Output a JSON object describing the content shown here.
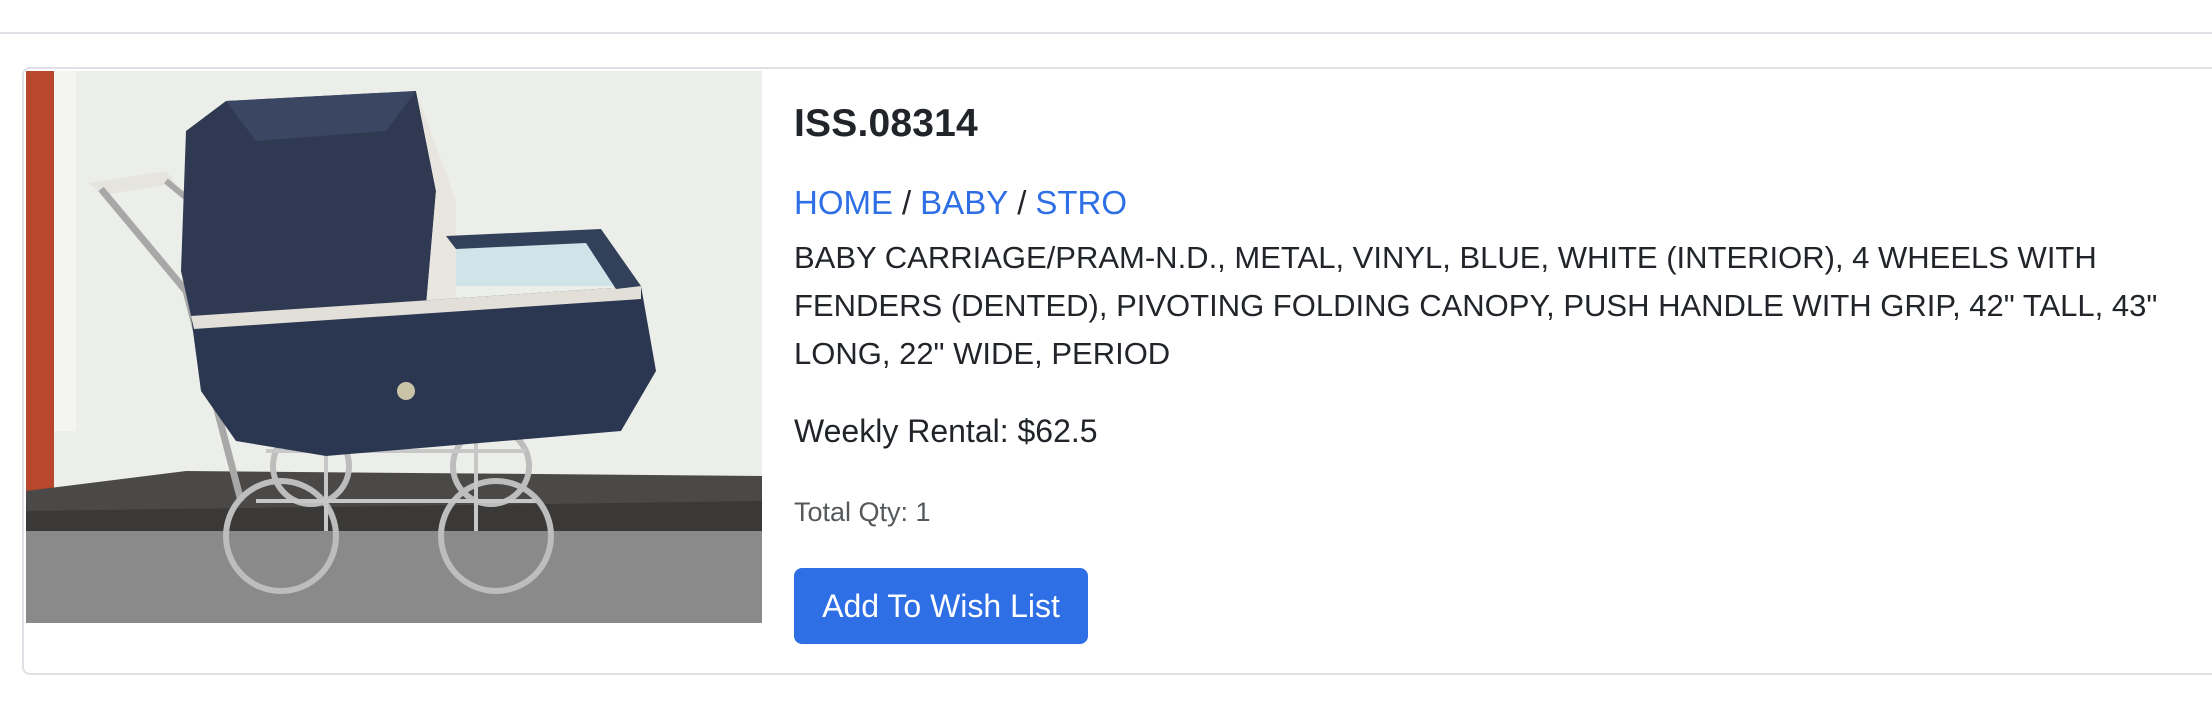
{
  "product": {
    "code": "ISS.08314",
    "breadcrumb": [
      {
        "label": "HOME"
      },
      {
        "label": "BABY"
      },
      {
        "label": "STRO"
      }
    ],
    "breadcrumb_separator": "/",
    "description": "BABY CARRIAGE/PRAM-N.D., METAL, VINYL, BLUE, WHITE (INTERIOR), 4 WHEELS WITH FENDERS (DENTED), PIVOTING FOLDING CANOPY, PUSH HANDLE WITH GRIP, 42\" TALL, 43\" LONG, 22\" WIDE, PERIOD",
    "weekly_rental": "Weekly Rental: $62.5",
    "total_qty": "Total Qty: 1",
    "wish_list_button": "Add To Wish List",
    "image_subject": "navy blue vintage baby carriage (pram) photo"
  },
  "colors": {
    "link": "#2f6fe6",
    "button": "#2f6fe6",
    "text": "#212529",
    "muted_text": "#55595c",
    "border": "#dee2e6",
    "photo_placeholder": "#8a8a8a"
  }
}
